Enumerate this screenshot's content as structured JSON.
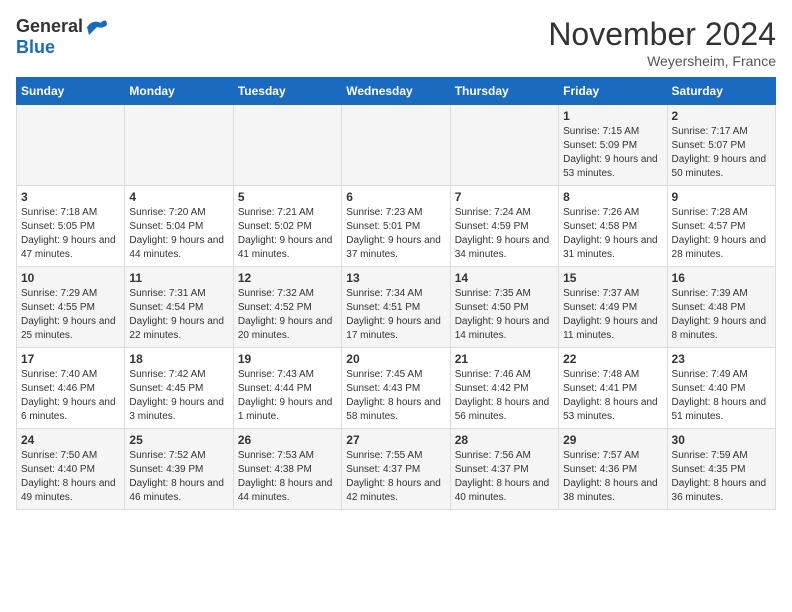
{
  "header": {
    "logo_general": "General",
    "logo_blue": "Blue",
    "month_title": "November 2024",
    "location": "Weyersheim, France"
  },
  "calendar": {
    "days_of_week": [
      "Sunday",
      "Monday",
      "Tuesday",
      "Wednesday",
      "Thursday",
      "Friday",
      "Saturday"
    ],
    "weeks": [
      [
        {
          "day": "",
          "info": ""
        },
        {
          "day": "",
          "info": ""
        },
        {
          "day": "",
          "info": ""
        },
        {
          "day": "",
          "info": ""
        },
        {
          "day": "",
          "info": ""
        },
        {
          "day": "1",
          "info": "Sunrise: 7:15 AM\nSunset: 5:09 PM\nDaylight: 9 hours and 53 minutes."
        },
        {
          "day": "2",
          "info": "Sunrise: 7:17 AM\nSunset: 5:07 PM\nDaylight: 9 hours and 50 minutes."
        }
      ],
      [
        {
          "day": "3",
          "info": "Sunrise: 7:18 AM\nSunset: 5:05 PM\nDaylight: 9 hours and 47 minutes."
        },
        {
          "day": "4",
          "info": "Sunrise: 7:20 AM\nSunset: 5:04 PM\nDaylight: 9 hours and 44 minutes."
        },
        {
          "day": "5",
          "info": "Sunrise: 7:21 AM\nSunset: 5:02 PM\nDaylight: 9 hours and 41 minutes."
        },
        {
          "day": "6",
          "info": "Sunrise: 7:23 AM\nSunset: 5:01 PM\nDaylight: 9 hours and 37 minutes."
        },
        {
          "day": "7",
          "info": "Sunrise: 7:24 AM\nSunset: 4:59 PM\nDaylight: 9 hours and 34 minutes."
        },
        {
          "day": "8",
          "info": "Sunrise: 7:26 AM\nSunset: 4:58 PM\nDaylight: 9 hours and 31 minutes."
        },
        {
          "day": "9",
          "info": "Sunrise: 7:28 AM\nSunset: 4:57 PM\nDaylight: 9 hours and 28 minutes."
        }
      ],
      [
        {
          "day": "10",
          "info": "Sunrise: 7:29 AM\nSunset: 4:55 PM\nDaylight: 9 hours and 25 minutes."
        },
        {
          "day": "11",
          "info": "Sunrise: 7:31 AM\nSunset: 4:54 PM\nDaylight: 9 hours and 22 minutes."
        },
        {
          "day": "12",
          "info": "Sunrise: 7:32 AM\nSunset: 4:52 PM\nDaylight: 9 hours and 20 minutes."
        },
        {
          "day": "13",
          "info": "Sunrise: 7:34 AM\nSunset: 4:51 PM\nDaylight: 9 hours and 17 minutes."
        },
        {
          "day": "14",
          "info": "Sunrise: 7:35 AM\nSunset: 4:50 PM\nDaylight: 9 hours and 14 minutes."
        },
        {
          "day": "15",
          "info": "Sunrise: 7:37 AM\nSunset: 4:49 PM\nDaylight: 9 hours and 11 minutes."
        },
        {
          "day": "16",
          "info": "Sunrise: 7:39 AM\nSunset: 4:48 PM\nDaylight: 9 hours and 8 minutes."
        }
      ],
      [
        {
          "day": "17",
          "info": "Sunrise: 7:40 AM\nSunset: 4:46 PM\nDaylight: 9 hours and 6 minutes."
        },
        {
          "day": "18",
          "info": "Sunrise: 7:42 AM\nSunset: 4:45 PM\nDaylight: 9 hours and 3 minutes."
        },
        {
          "day": "19",
          "info": "Sunrise: 7:43 AM\nSunset: 4:44 PM\nDaylight: 9 hours and 1 minute."
        },
        {
          "day": "20",
          "info": "Sunrise: 7:45 AM\nSunset: 4:43 PM\nDaylight: 8 hours and 58 minutes."
        },
        {
          "day": "21",
          "info": "Sunrise: 7:46 AM\nSunset: 4:42 PM\nDaylight: 8 hours and 56 minutes."
        },
        {
          "day": "22",
          "info": "Sunrise: 7:48 AM\nSunset: 4:41 PM\nDaylight: 8 hours and 53 minutes."
        },
        {
          "day": "23",
          "info": "Sunrise: 7:49 AM\nSunset: 4:40 PM\nDaylight: 8 hours and 51 minutes."
        }
      ],
      [
        {
          "day": "24",
          "info": "Sunrise: 7:50 AM\nSunset: 4:40 PM\nDaylight: 8 hours and 49 minutes."
        },
        {
          "day": "25",
          "info": "Sunrise: 7:52 AM\nSunset: 4:39 PM\nDaylight: 8 hours and 46 minutes."
        },
        {
          "day": "26",
          "info": "Sunrise: 7:53 AM\nSunset: 4:38 PM\nDaylight: 8 hours and 44 minutes."
        },
        {
          "day": "27",
          "info": "Sunrise: 7:55 AM\nSunset: 4:37 PM\nDaylight: 8 hours and 42 minutes."
        },
        {
          "day": "28",
          "info": "Sunrise: 7:56 AM\nSunset: 4:37 PM\nDaylight: 8 hours and 40 minutes."
        },
        {
          "day": "29",
          "info": "Sunrise: 7:57 AM\nSunset: 4:36 PM\nDaylight: 8 hours and 38 minutes."
        },
        {
          "day": "30",
          "info": "Sunrise: 7:59 AM\nSunset: 4:35 PM\nDaylight: 8 hours and 36 minutes."
        }
      ]
    ]
  }
}
